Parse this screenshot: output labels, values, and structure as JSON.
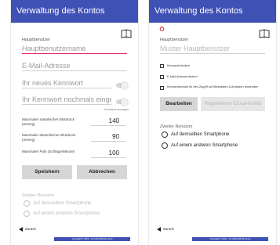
{
  "left": {
    "title": "Verwaltung des Kontos",
    "main_user_label": "Hauptbenutzer",
    "main_user_placeholder": "Hauptbenutzername",
    "email_placeholder": "E-Mail-Adresse",
    "new_password_placeholder": "Ihr neues Kennwort",
    "repeat_password_placeholder": "Ihr Kennwort nochmals eingeb",
    "show_password_label": "Kennwort anzeigen",
    "limits": [
      {
        "label": "Maximaler systolischer Blutdruck (mmHg)",
        "value": "140"
      },
      {
        "label": "Maximaler diastolischer Blutdruck (mmHg)",
        "value": "90"
      },
      {
        "label": "Maximaler Puls (Schläge/Minute)",
        "value": "100"
      }
    ],
    "save_label": "Speishern",
    "cancel_label": "Abbrechen",
    "second_user_label": "Zweiter Benutzer",
    "radio_same": "Auf demselben Smartphone",
    "radio_other": "Auf einem anderen Smartphone",
    "back_label": "Zurück",
    "footer": "Copyright © 2020 · by GIGA DRIVE Team"
  },
  "right": {
    "title": "Verwaltung des Kontos",
    "main_user_label": "Hauptbenutzer",
    "main_user_value": "Muster Hauptbenutzer",
    "checkboxes": [
      "Kennwort ändern",
      "E-Mail-Adresse ändern",
      "Kennwortschutz für den Zugriff auf Messdaten & Analysen anwenden"
    ],
    "edit_label": "Bearbeiten",
    "register_label": "Registrieren Cloud-Konto",
    "second_user_label": "Zweiter Benutzer",
    "radio_same": "Auf demselben Smartphone",
    "radio_other": "Auf einem anderen Smartphone",
    "back_label": "Zurück",
    "footer": "Copyright © 2020 · by GIGA DRIVE Team"
  },
  "colors": {
    "appbar": "#3f51b5",
    "accent": "#e0245e"
  }
}
